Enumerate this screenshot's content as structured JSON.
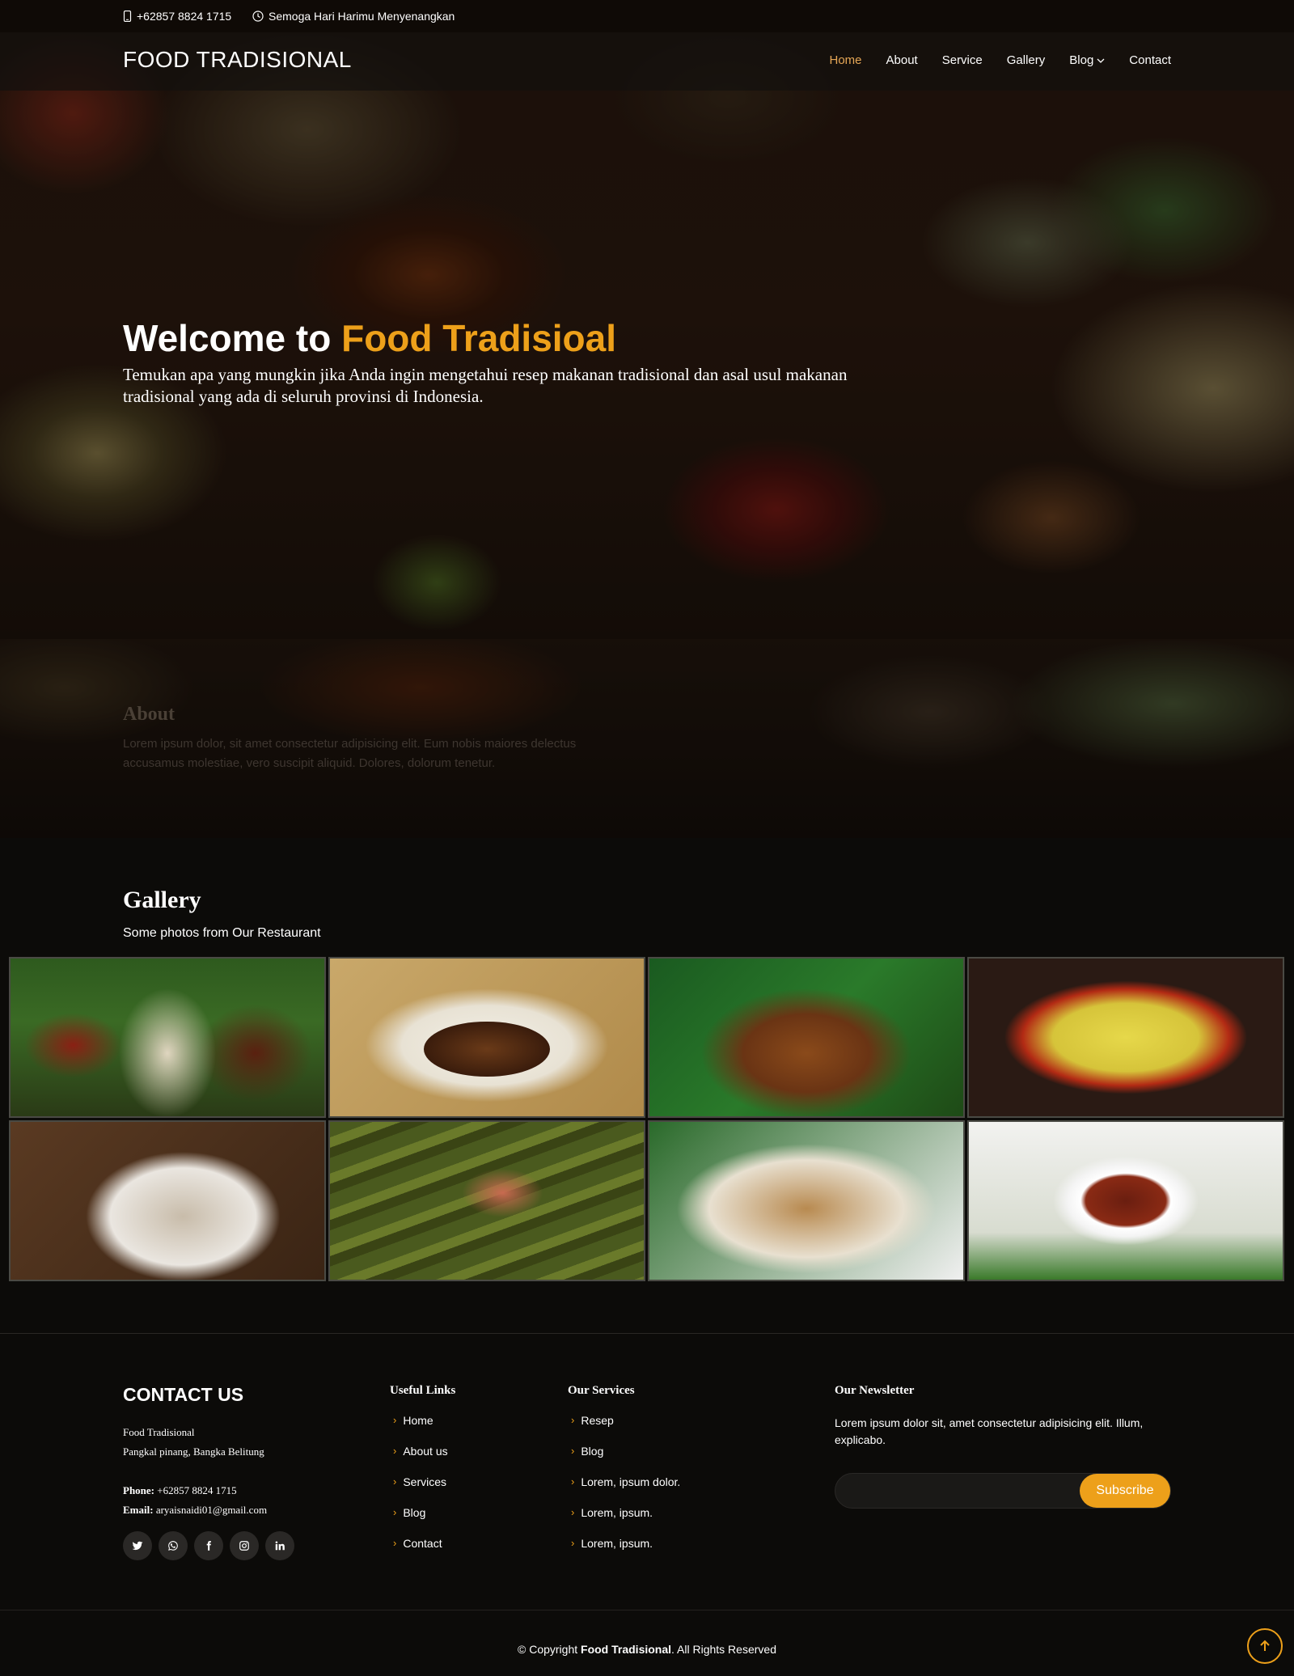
{
  "topbar": {
    "phone": "+62857 8824 1715",
    "greeting": "Semoga Hari Harimu Menyenangkan"
  },
  "header": {
    "logo": "FOOD TRADISIONAL",
    "nav": [
      "Home",
      "About",
      "Service",
      "Gallery",
      "Blog",
      "Contact"
    ],
    "active": "Home"
  },
  "hero": {
    "title_prefix": "Welcome to ",
    "title_accent": "Food Tradisioal",
    "description": "Temukan apa yang mungkin jika Anda ingin mengetahui resep makanan tradisional dan asal usul makanan tradisional yang ada di seluruh provinsi di Indonesia."
  },
  "about": {
    "title": "About",
    "text": "Lorem ipsum dolor, sit amet consectetur adipisicing elit. Eum nobis maiores delectus accusamus molestiae, vero suscipit aliquid. Dolores, dolorum tenetur."
  },
  "gallery": {
    "title": "Gallery",
    "subtitle": "Some photos from Our Restaurant"
  },
  "footer": {
    "contact_title": "CONTACT US",
    "address_line1": "Food Tradisional",
    "address_line2": "Pangkal pinang, Bangka Belitung",
    "phone_label": "Phone:",
    "phone": "+62857 8824 1715",
    "email_label": "Email:",
    "email": "aryaisnaidi01@gmail.com",
    "useful_links_title": "Useful Links",
    "useful_links": [
      "Home",
      "About us",
      "Services",
      "Blog",
      "Contact"
    ],
    "services_title": "Our Services",
    "services": [
      "Resep",
      "Blog",
      "Lorem, ipsum dolor.",
      "Lorem, ipsum.",
      "Lorem, ipsum."
    ],
    "newsletter_title": "Our Newsletter",
    "newsletter_text": "Lorem ipsum dolor sit, amet consectetur adipisicing elit. Illum, explicabo.",
    "subscribe_label": "Subscribe",
    "email_placeholder": ""
  },
  "copyright": {
    "prefix": "© Copyright ",
    "brand": "Food Tradisional",
    "suffix": ". All Rights Reserved"
  },
  "colors": {
    "accent": "#eda01a",
    "nav_active": "#e6a756",
    "background": "#0c0b09"
  }
}
